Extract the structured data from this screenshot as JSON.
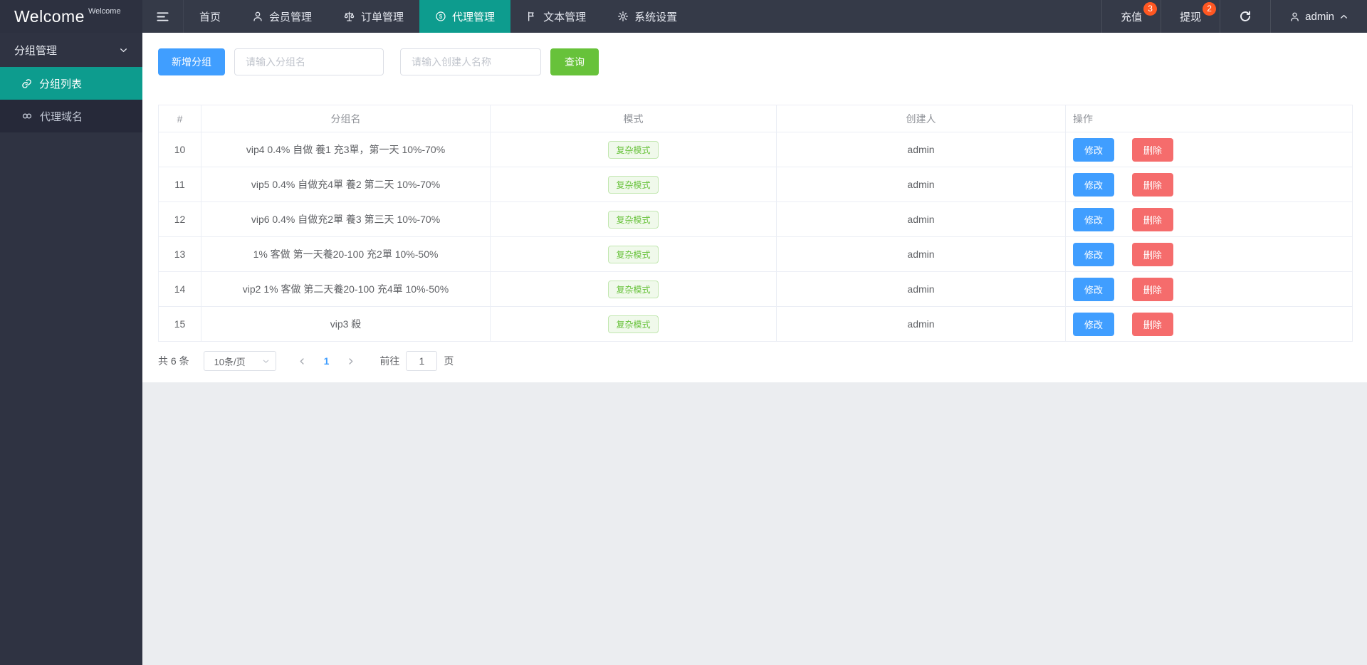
{
  "brand": {
    "name": "Welcome",
    "tag": "Welcome"
  },
  "navbar": {
    "items": [
      {
        "label": "首页",
        "active": false
      },
      {
        "label": "会员管理",
        "active": false
      },
      {
        "label": "订单管理",
        "active": false
      },
      {
        "label": "代理管理",
        "active": true
      },
      {
        "label": "文本管理",
        "active": false
      },
      {
        "label": "系统设置",
        "active": false
      }
    ],
    "right": {
      "recharge": {
        "label": "充值",
        "badge": "3"
      },
      "withdraw": {
        "label": "提现",
        "badge": "2"
      },
      "user": {
        "name": "admin"
      }
    }
  },
  "sidebar": {
    "group_title": "分组管理",
    "items": [
      {
        "label": "分组列表",
        "active": true
      },
      {
        "label": "代理域名",
        "active": false
      }
    ]
  },
  "toolbar": {
    "add_label": "新增分组",
    "group_placeholder": "请输入分组名",
    "creator_placeholder": "请输入创建人名称",
    "search_label": "查询"
  },
  "table": {
    "columns": [
      "#",
      "分组名",
      "模式",
      "创建人",
      "操作"
    ],
    "mode_badge": "复杂模式",
    "actions": {
      "edit": "修改",
      "delete": "删除"
    },
    "rows": [
      {
        "id": "10",
        "name": "vip4 0.4% 自做 養1 充3單，第一天 10%-70%",
        "creator": "admin"
      },
      {
        "id": "11",
        "name": "vip5 0.4% 自做充4單 養2 第二天 10%-70%",
        "creator": "admin"
      },
      {
        "id": "12",
        "name": "vip6 0.4% 自做充2單 養3 第三天 10%-70%",
        "creator": "admin"
      },
      {
        "id": "13",
        "name": "1% 客做 第一天養20-100 充2單 10%-50%",
        "creator": "admin"
      },
      {
        "id": "14",
        "name": "vip2 1% 客做 第二天養20-100 充4單 10%-50%",
        "creator": "admin"
      },
      {
        "id": "15",
        "name": "vip3 殺",
        "creator": "admin"
      }
    ]
  },
  "pagination": {
    "total_text": "共 6 条",
    "page_size": "10条/页",
    "current_page": "1",
    "goto_label": "前往",
    "goto_value": "1",
    "goto_suffix": "页"
  },
  "colors": {
    "primary_blue": "#409eff",
    "success_green": "#67c23a",
    "danger_red": "#f56c6c",
    "active_teal": "#0d9c8e",
    "badge_orange": "#ff5722",
    "navbar_dark": "#353a48",
    "sidebar_dark": "#2f3342"
  }
}
